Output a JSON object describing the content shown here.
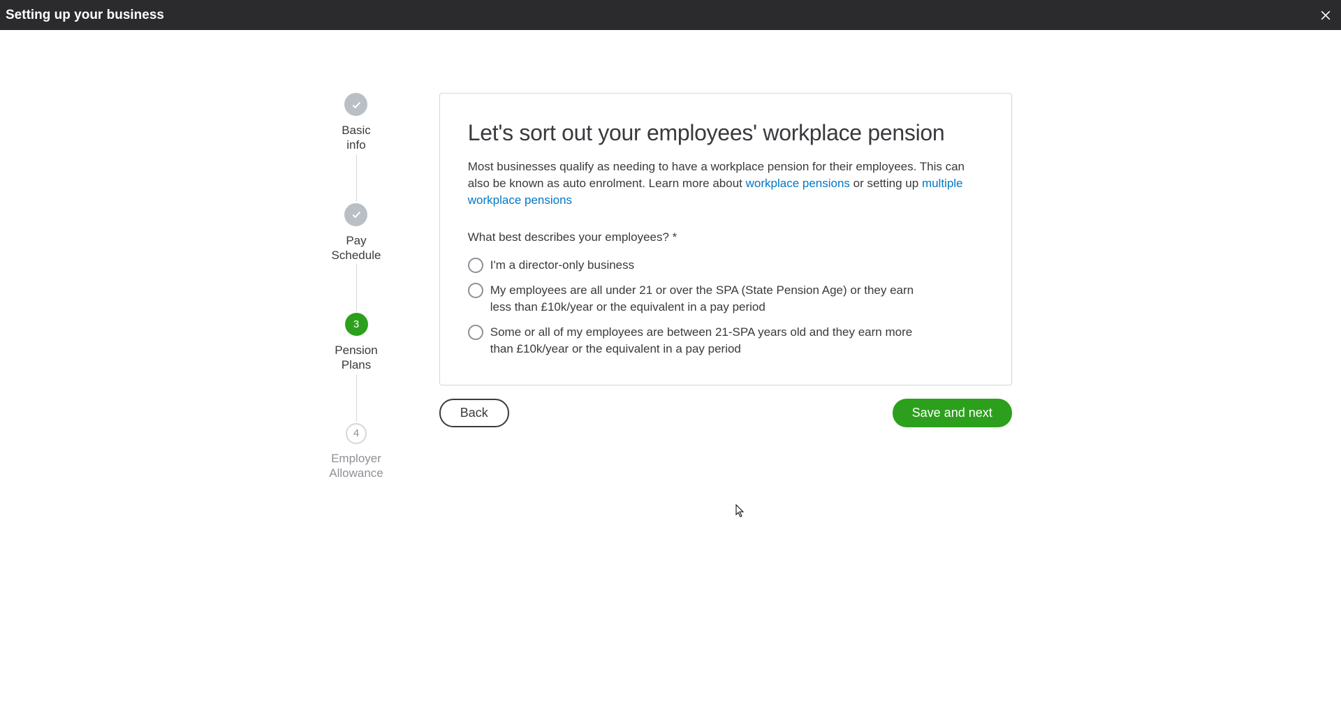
{
  "header": {
    "title": "Setting up your business"
  },
  "stepper": {
    "steps": [
      {
        "label_line1": "Basic",
        "label_line2": "info",
        "state": "completed"
      },
      {
        "label_line1": "Pay",
        "label_line2": "Schedule",
        "state": "completed"
      },
      {
        "number": "3",
        "label_line1": "Pension",
        "label_line2": "Plans",
        "state": "active"
      },
      {
        "number": "4",
        "label_line1": "Employer",
        "label_line2": "Allowance",
        "state": "incomplete"
      }
    ]
  },
  "card": {
    "title": "Let's sort out your employees' workplace pension",
    "description_pre": "Most businesses qualify as needing to have a workplace pension for their employees. This can also be known as auto enrolment. Learn more about ",
    "link1": "workplace pensions",
    "description_mid": " or setting up ",
    "link2": "multiple workplace pensions",
    "question": "What best describes your employees? *",
    "options": [
      "I'm a director-only business",
      "My employees are all under 21 or over the SPA (State Pension Age) or they earn less than £10k/year or the equivalent in a pay period",
      "Some or all of my employees are between 21-SPA years old and they earn more than £10k/year or the equivalent in a pay period"
    ]
  },
  "buttons": {
    "back": "Back",
    "save_next": "Save and next"
  }
}
